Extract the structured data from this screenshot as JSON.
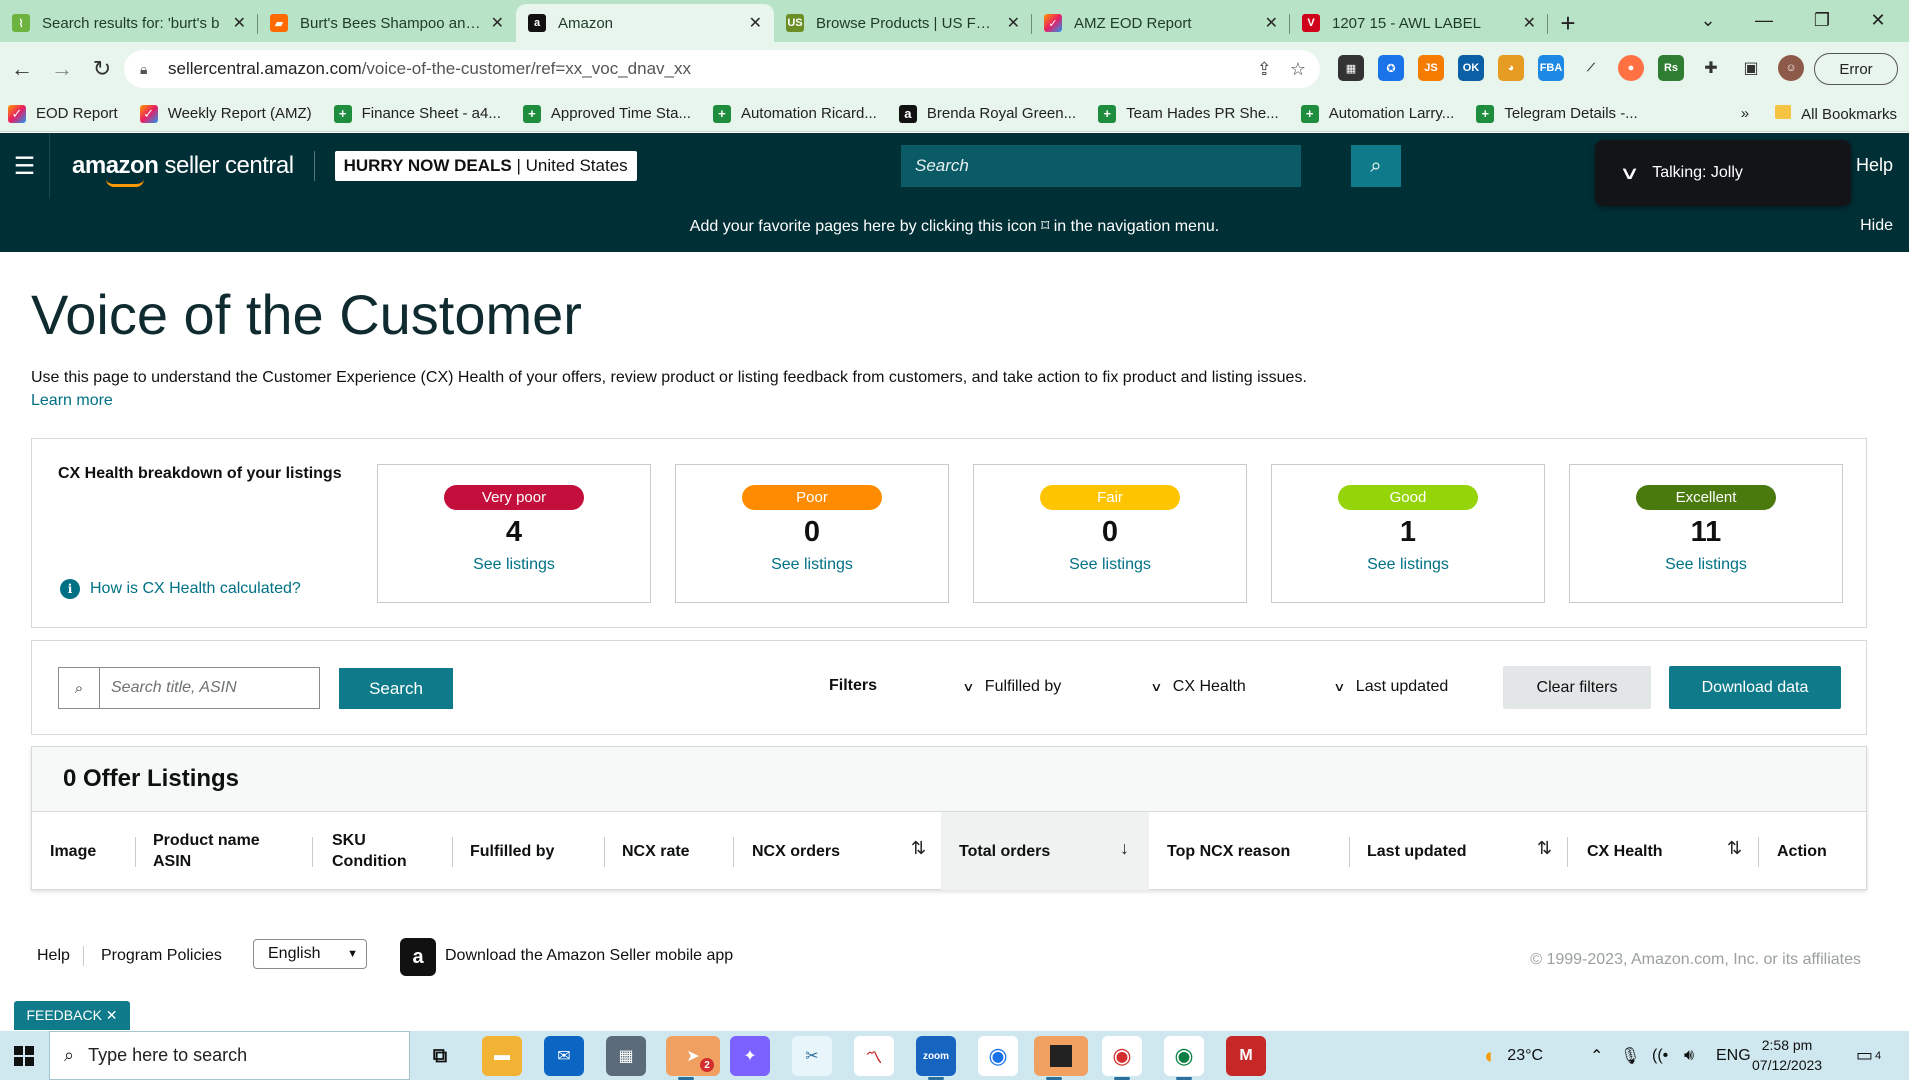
{
  "browser": {
    "tabs": [
      {
        "label": "Search results for: 'burt's b",
        "icon": "grass-icon",
        "color": "#6db33f"
      },
      {
        "label": "Burt's Bees Shampoo and V",
        "icon": "shop-icon",
        "color": "#ff6a00"
      },
      {
        "label": "Amazon",
        "icon": "amazon-icon",
        "color": "#111111",
        "active": true
      },
      {
        "label": "Browse Products | US Food",
        "icon": "usfoods-icon",
        "color": "#6a8e23"
      },
      {
        "label": "AMZ EOD Report",
        "icon": "sheets-color-icon",
        "color": "#e91e63"
      },
      {
        "label": "1207 15 - AWL LABEL",
        "icon": "redv-icon",
        "color": "#d0021b"
      }
    ],
    "new_tab": "+",
    "url_host": "sellercentral.amazon.com",
    "url_path": "/voice-of-the-customer/ref=xx_voc_dnav_xx",
    "profile_status": "Error",
    "bookmarks": [
      {
        "label": "EOD Report",
        "icon": "color"
      },
      {
        "label": "Weekly Report (AMZ)",
        "icon": "color"
      },
      {
        "label": "Finance Sheet - a4...",
        "icon": "plus"
      },
      {
        "label": "Approved Time Sta...",
        "icon": "plus"
      },
      {
        "label": "Automation Ricard...",
        "icon": "plus"
      },
      {
        "label": "Brenda Royal Green...",
        "icon": "amz"
      },
      {
        "label": "Team Hades PR She...",
        "icon": "plus"
      },
      {
        "label": "Automation Larry...",
        "icon": "plus"
      },
      {
        "label": "Telegram Details -...",
        "icon": "plus"
      }
    ],
    "bookmarks_overflow": "»",
    "all_bookmarks": "All Bookmarks"
  },
  "header": {
    "logo_bold": "amazon",
    "logo_rest": " seller central",
    "store_name": "HURRY NOW DEALS",
    "marketplace": "| United States",
    "search_placeholder": "Search",
    "talking": "Talking: Jolly",
    "help": "Help",
    "fav_bar_text": "Add your favorite pages here by clicking this icon ⌑ in the navigation menu.",
    "hide": "Hide"
  },
  "page": {
    "title": "Voice of the Customer",
    "description": "Use this page to understand the Customer Experience (CX) Health of your offers, review product or listing feedback from customers, and take action to fix product and listing issues.",
    "learn_more": "Learn more",
    "cx_title": "CX Health breakdown of your listings",
    "cx_how": "How is CX Health calculated?",
    "cx_cards": [
      {
        "label": "Very poor",
        "count": "4",
        "link": "See listings",
        "color": "#c40f3c",
        "text_color": "#ffffff"
      },
      {
        "label": "Poor",
        "count": "0",
        "link": "See listings",
        "color": "#ff8c00",
        "text_color": "#ffffff"
      },
      {
        "label": "Fair",
        "count": "0",
        "link": "See listings",
        "color": "#ffc400",
        "text_color": "#ffffff"
      },
      {
        "label": "Good",
        "count": "1",
        "link": "See listings",
        "color": "#96d40a",
        "text_color": "#ffffff"
      },
      {
        "label": "Excellent",
        "count": "11",
        "link": "See listings",
        "color": "#4a7a0e",
        "text_color": "#ffffff"
      }
    ],
    "search_placeholder": "Search title, ASIN",
    "search_button": "Search",
    "filters_label": "Filters",
    "filter_fulfilled": "Fulfilled by",
    "filter_cx": "CX Health",
    "filter_updated": "Last updated",
    "clear_filters": "Clear filters",
    "download": "Download data",
    "offer_count": "0 Offer Listings",
    "columns": {
      "image": "Image",
      "product_line1": "Product name",
      "product_line2": "ASIN",
      "sku_line1": "SKU",
      "sku_line2": "Condition",
      "fulfilled": "Fulfilled by",
      "ncx_rate": "NCX rate",
      "ncx_orders": "NCX orders",
      "total_orders": "Total orders",
      "top_reason": "Top NCX reason",
      "last_updated": "Last updated",
      "cx_health": "CX Health",
      "action": "Action"
    }
  },
  "footer": {
    "help": "Help",
    "policies": "Program Policies",
    "language": "English",
    "app": "Download the Amazon Seller mobile app",
    "copyright": "© 1999-2023, Amazon.com, Inc. or its affiliates",
    "feedback": "FEEDBACK ✕"
  },
  "taskbar": {
    "search_placeholder": "Type here to search",
    "temperature": "23°C",
    "language": "ENG",
    "time": "2:58 pm",
    "date": "07/12/2023",
    "telegram_badge": "2",
    "notif_count": "4"
  }
}
